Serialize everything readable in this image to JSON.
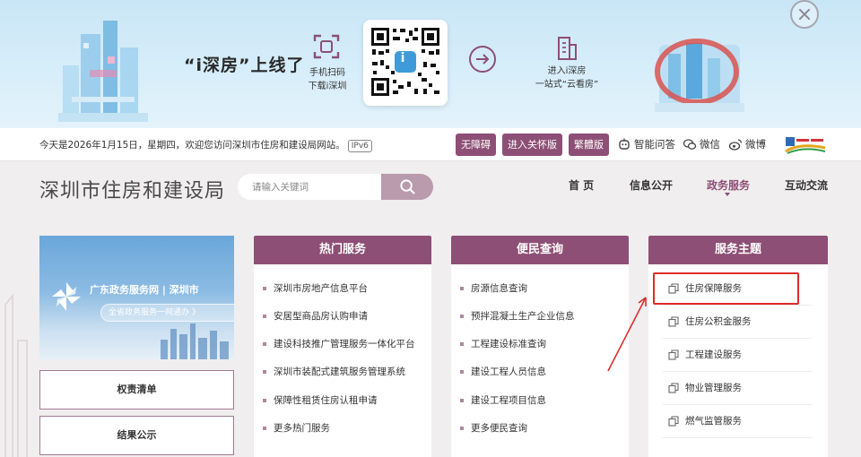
{
  "banner": {
    "headline": "“i深房”上线了",
    "scan_line1": "手机扫码",
    "scan_line2": "下载i深圳",
    "enter_line1": "进入i深房",
    "enter_line2": "一站式“云看房”",
    "qr_badge": "i"
  },
  "topbar": {
    "welcome": "今天是2026年1月15日，星期四，欢迎您访问深圳市住房和建设局网站。",
    "ipv6": "IPv6",
    "buttons": [
      "无障碍",
      "进入关怀版",
      "繁體版"
    ],
    "links": {
      "ai": "智能问答",
      "wechat": "微信",
      "weibo": "微博"
    },
    "accent": "#8d4f75"
  },
  "header": {
    "site_title": "深圳市住房和建设局",
    "search_placeholder": "请输入关键词",
    "nav": [
      "首 页",
      "信息公开",
      "政务服务",
      "互动交流"
    ],
    "active_nav": "政务服务"
  },
  "left": {
    "gd_title": "广东政务服务网 | 深圳市",
    "gd_slogan": "全省政务服务一网通办 》",
    "buttons": [
      "权责清单",
      "结果公示"
    ]
  },
  "hot_services": {
    "title": "热门服务",
    "items": [
      "深圳市房地产信息平台",
      "安居型商品房认购申请",
      "建设科技推广管理服务一体化平台",
      "深圳市装配式建筑服务管理系统",
      "保障性租赁住房认租申请",
      "更多热门服务"
    ]
  },
  "public_query": {
    "title": "便民查询",
    "items": [
      "房源信息查询",
      "预拌混凝土生产企业信息",
      "工程建设标准查询",
      "建设工程人员信息",
      "建设工程项目信息",
      "更多便民查询"
    ]
  },
  "service_themes": {
    "title": "服务主题",
    "items": [
      "住房保障服务",
      "住房公积金服务",
      "工程建设服务",
      "物业管理服务",
      "燃气监管服务"
    ],
    "highlight_color": "#e02a2a"
  }
}
